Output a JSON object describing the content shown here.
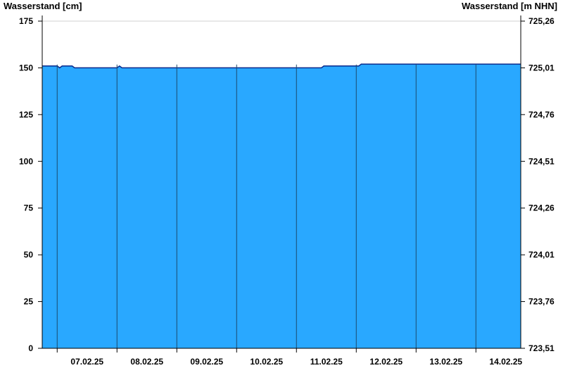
{
  "chart_data": {
    "type": "area",
    "title": "",
    "ylabel_left": "Wasserstand [cm]",
    "ylabel_right": "Wasserstand [m NHN]",
    "ylim": [
      0,
      175
    ],
    "yticks_left": [
      0,
      25,
      50,
      75,
      100,
      125,
      150,
      175
    ],
    "yticks_right": [
      "723,51",
      "723,76",
      "724,01",
      "724,26",
      "724,51",
      "724,76",
      "725,01",
      "725,26"
    ],
    "xlim": [
      "2025-02-06 18:00",
      "2025-02-14 18:00"
    ],
    "x_tick_labels": [
      "07.02.25",
      "08.02.25",
      "09.02.25",
      "10.02.25",
      "11.02.25",
      "12.02.25",
      "13.02.25",
      "14.02.25"
    ],
    "series": [
      {
        "x": [
          "2025-02-06 18:00",
          "2025-02-07 00:00",
          "2025-02-07 01:00",
          "2025-02-07 02:00",
          "2025-02-07 06:00",
          "2025-02-07 07:00",
          "2025-02-08 00:00",
          "2025-02-08 01:00",
          "2025-02-08 02:00",
          "2025-02-09 00:00",
          "2025-02-10 00:00",
          "2025-02-11 00:00",
          "2025-02-11 10:00",
          "2025-02-11 11:00",
          "2025-02-12 00:00",
          "2025-02-12 01:00",
          "2025-02-12 02:00",
          "2025-02-13 00:00",
          "2025-02-14 00:00",
          "2025-02-14 18:00"
        ],
        "values": [
          151,
          151,
          150,
          151,
          151,
          150,
          150,
          151,
          150,
          150,
          150,
          150,
          150,
          151,
          151,
          151,
          152,
          152,
          152,
          152
        ]
      }
    ],
    "colors": {
      "fill": "#29a8ff",
      "line": "#0a2a8c",
      "grid": "#1a4a6e",
      "axis": "#000000"
    },
    "grid": "vertical day separators"
  }
}
